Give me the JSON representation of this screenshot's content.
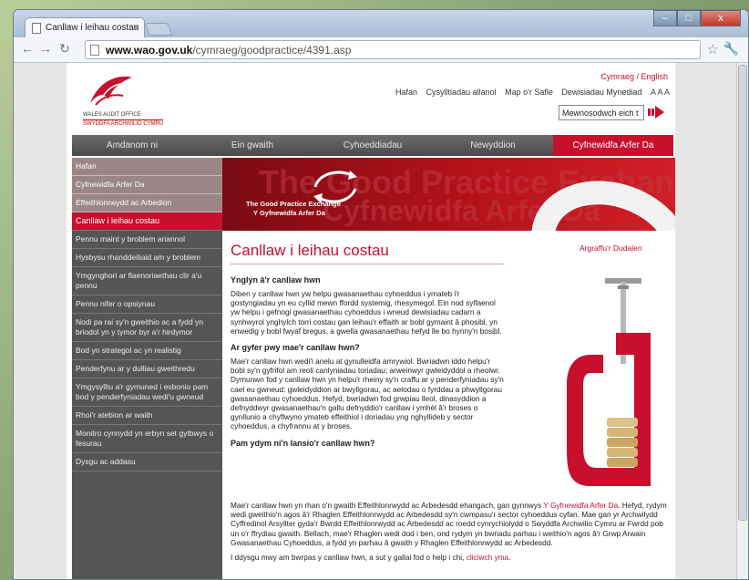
{
  "browser": {
    "tab_title": "Canllaw i leihau costau",
    "tab_close": "×",
    "url_host": "www.wao.gov.uk",
    "url_path": "/cymraeg/goodpractice/4391.asp",
    "window_min": "–",
    "window_max": "□",
    "window_close": "x"
  },
  "header": {
    "logo_line1": "WALES AUDIT OFFICE",
    "logo_line2": "SWYDDFA ARCHWILIO CYMRU",
    "lang_cymraeg": "Cymraeg",
    "lang_sep": " / ",
    "lang_english": "English",
    "links": [
      "Hafan",
      "Cysylltiadau allanol",
      "Map o'r Safle",
      "Dewisiadau Mynediad"
    ],
    "text_size": "A A A",
    "search_value": "Mewnosodwch eich t"
  },
  "main_nav": [
    "Amdanom ni",
    "Ein gwaith",
    "Cyhoeddiadau",
    "Newyddion",
    "Cyfnewidfa Arfer Da"
  ],
  "sidebar": {
    "top_items": [
      "Hafan",
      "Cyfnewidfa Arfer Da",
      "Effeithlonrwydd ac Arbedion",
      "Canllaw i leihau costau"
    ],
    "items": [
      "Pennu maint y broblem ariannol",
      "Hysbysu rhanddeiliaid am y broblem",
      "Ymgynghori ar flaenoriaethau clir a'u pennu",
      "Pennu nifer o opsiynau",
      "Nodi pa rai sy'n gweithio ac a fydd yn briodol yn y tymor byr a'r hirdymor",
      "Bod yn strategol ac yn realistig",
      "Penderfynu ar y dulliau gweithredu",
      "Ymgysylltu a'r gymuned i esbonio pam bod y penderfyniadau wedi'u gwneud",
      "Rhoi'r atebion ar waith",
      "Monitro cynnydd yn erbyn set gytbwys o fesurau",
      "Dysgu ac addasu"
    ]
  },
  "banner": {
    "ghost1": "The Good Practice Exchange",
    "ghost2": "Cyfnewidfa Arfer Da",
    "caption1": "The Good Practice Exchange",
    "caption2": "Y Gyfnewidfa Arfer Da"
  },
  "content": {
    "title": "Canllaw i leihau costau",
    "print": "Argraffu'r Dudalen",
    "h1": "Ynglyn â'r canllaw hwn",
    "p1": "Diben y canllaw hwn yw helpu gwasanaethau cyhoeddus i ymateb i'r gostyngiadau yn eu cyllid mewn ffordd systemig, rhesymegol. Ein nod sylfaenol yw helpu i gefnogi gwasanaethau cyhoeddus i wneud dewisiadau cadarn a synhwyrol ynghylch torri costau gan leihau'r effaith ar bobl gymaint â phosibl, yn enwedig y bobl fwyaf bregus, a gwella gwasanaethau hefyd lle bo hynny'n bosibl.",
    "h2": "Ar gyfer pwy mae'r canllaw hwn?",
    "p2": "Mae'r canllaw hwn wedi'i anelu at gynulleidfa amrywiol. Bwriadwn iddo helpu'r bobl sy'n gyfrifol am reoli canlyniadau toriadau; arweinwyr gwleidyddol a rheolwr. Dymunwn fod y canllaw hwn yn helpu'r rheiny sy'n craffu ar y penderfyniadau sy'n cael eu gwneud: gwleidyddion ar bwyllgorau, ac aelodau o fyrddau a phwyllgorau gwasanaethau cyhoeddus. Hefyd, bwriadwn fod grwpiau lleol, dinasyddion a defnyddwyr gwasanaethau'n gallu defnyddio'r canllaw i ymhél â'r broses o gynllunio a chyflwyno ymateb effeithiol i doriadau yng nghyllideb y sector cyhoeddus, a chyfrannu at y broses.",
    "h3": "Pam ydym ni'n lansio'r canllaw hwn?",
    "p3a": "Mae'r canllaw hwn yn rhan o'n gwaith Effeithlonrwydd ac Arbedesdd ehangach, gan gynnwys ",
    "p3link": "Y Gyfnewidfa Arfer Da",
    "p3b": ". Hefyd, rydym wedi gweithio'n agos â'r Rhaglen Effeithlonrwydd ac Arbedesdd sy'n cwmpasu'r sector cyhoeddus cyfan. Mae gan yr Archwilydd Cyffredinol Arsyllter gyda'r Bwrdd Effeithlonrwydd ac Arbedesdd ac roedd cynrychiolydd o Swyddfa Archwilio Cymru ar Fwrdd pob un o'r ffrydiau gwaith. Bellach, mae'r Rhaglen wedi dod i ben, ond rydym yn bwriadu parhau i weithio'n agos â'r Grwp Arwain Gwasanaethau Cyhoeddus, a fydd yn parhau â gwaith y Rhaglen Effeithlonrwydd ac Arbedesdd.",
    "p4a": "I ddysgu mwy am bwrpas y canllaw hwn, a sut y gallai fod o help i chi, ",
    "p4link": "cliciwch yma."
  }
}
